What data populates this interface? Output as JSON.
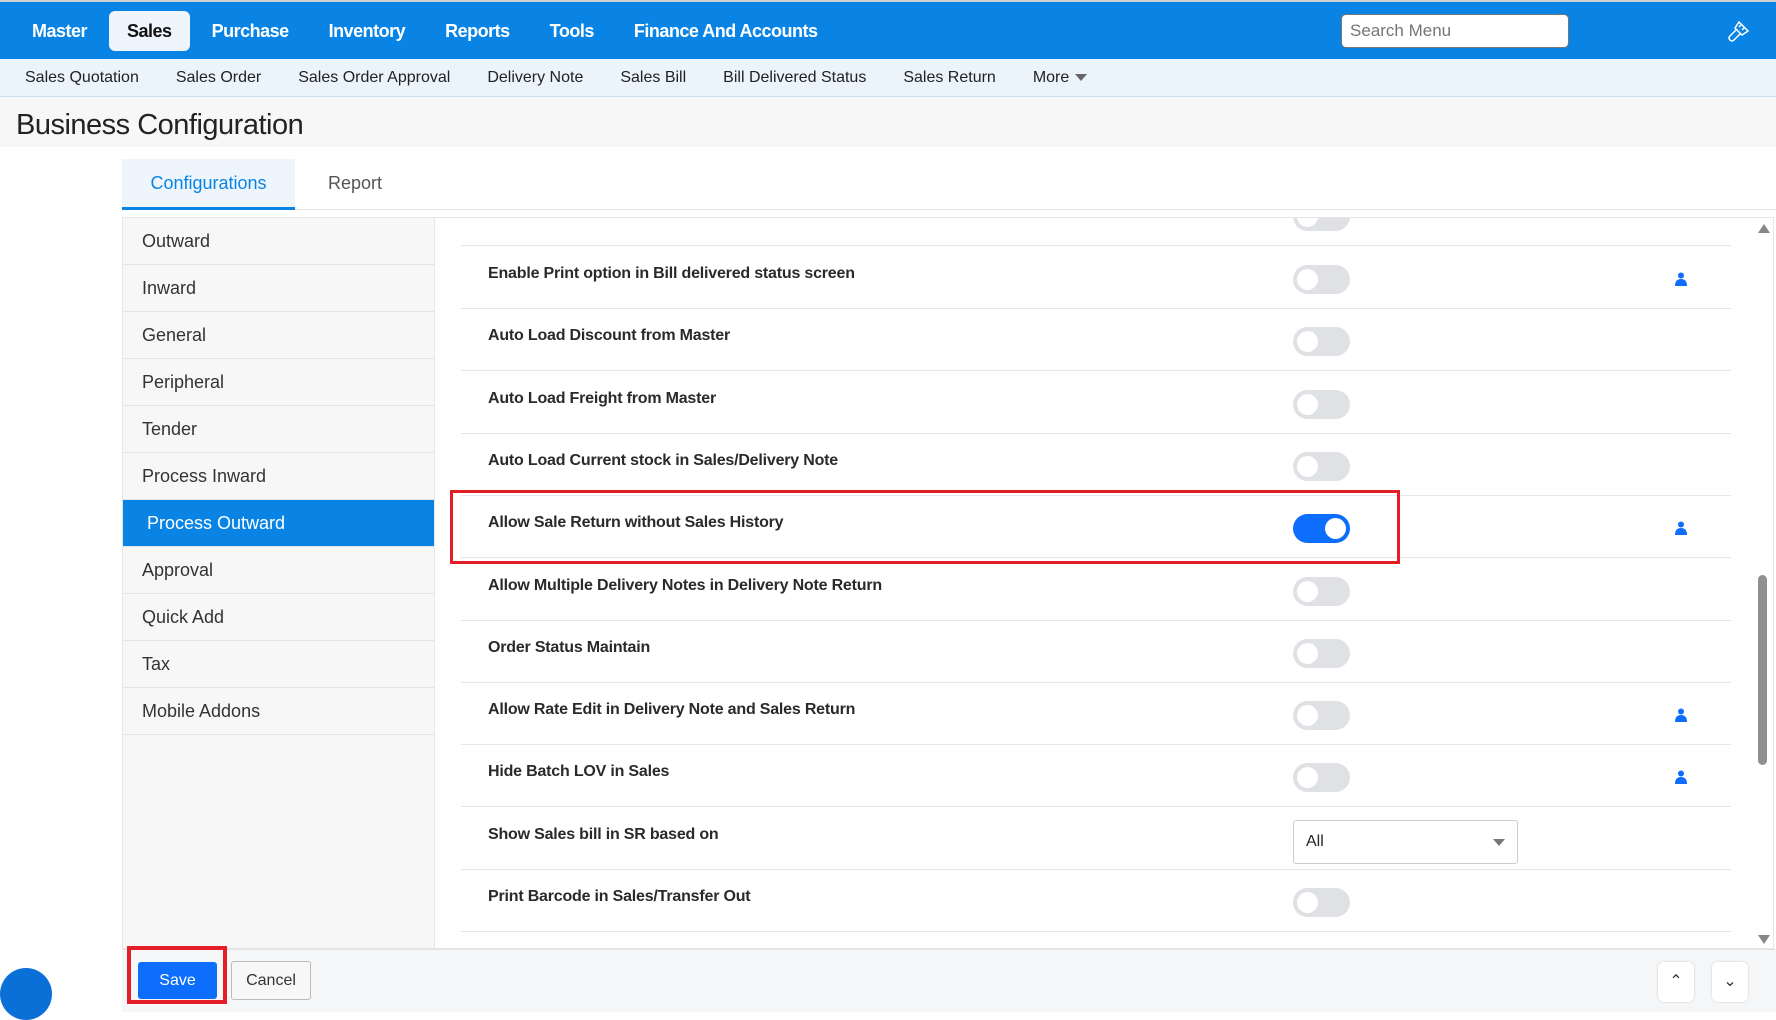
{
  "topnav": {
    "items": [
      "Master",
      "Sales",
      "Purchase",
      "Inventory",
      "Reports",
      "Tools",
      "Finance And Accounts"
    ],
    "active": "Sales",
    "search_placeholder": "Search Menu"
  },
  "subnav": {
    "items": [
      "Sales Quotation",
      "Sales Order",
      "Sales Order Approval",
      "Delivery Note",
      "Sales Bill",
      "Bill Delivered Status",
      "Sales Return"
    ],
    "more": "More"
  },
  "page_title": "Business Configuration",
  "tabs": {
    "configurations": "Configurations",
    "report": "Report"
  },
  "sidebar": {
    "items": [
      "Outward",
      "Inward",
      "General",
      "Peripheral",
      "Tender",
      "Process Inward",
      "Process Outward",
      "Approval",
      "Quick Add",
      "Tax",
      "Mobile Addons"
    ],
    "active": "Process Outward"
  },
  "settings": [
    {
      "label": "Enable Print option in Bill delivered status screen",
      "type": "toggle",
      "on": false,
      "user_icon": true
    },
    {
      "label": "Auto Load Discount from Master",
      "type": "toggle",
      "on": false,
      "user_icon": false
    },
    {
      "label": "Auto Load Freight from Master",
      "type": "toggle",
      "on": false,
      "user_icon": false
    },
    {
      "label": "Auto Load Current stock in Sales/Delivery Note",
      "type": "toggle",
      "on": false,
      "user_icon": false
    },
    {
      "label": "Allow Sale Return without Sales History",
      "type": "toggle",
      "on": true,
      "user_icon": true
    },
    {
      "label": "Allow Multiple Delivery Notes in Delivery Note Return",
      "type": "toggle",
      "on": false,
      "user_icon": false
    },
    {
      "label": "Order Status Maintain",
      "type": "toggle",
      "on": false,
      "user_icon": false
    },
    {
      "label": "Allow Rate Edit in Delivery Note and Sales Return",
      "type": "toggle",
      "on": false,
      "user_icon": true
    },
    {
      "label": "Hide Batch LOV in Sales",
      "type": "toggle",
      "on": false,
      "user_icon": true
    },
    {
      "label": "Show Sales bill in SR based on",
      "type": "select",
      "value": "All",
      "user_icon": false
    },
    {
      "label": "Print Barcode in Sales/Transfer Out",
      "type": "toggle",
      "on": false,
      "user_icon": false
    }
  ],
  "footer": {
    "save": "Save",
    "cancel": "Cancel"
  },
  "colors": {
    "brand": "#0a84e4",
    "toggle_on": "#0d6efd",
    "highlight": "#e41e26"
  }
}
